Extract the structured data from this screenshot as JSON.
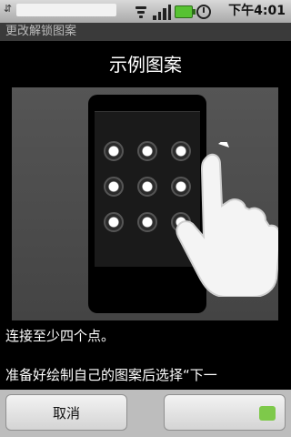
{
  "status_bar": {
    "time": "下午4:01",
    "icons": [
      "usb-icon",
      "wifi-icon",
      "signal-icon",
      "battery-icon",
      "alarm-icon"
    ],
    "battery_color": "#57c232"
  },
  "titlebar": {
    "text": "更改解锁图案"
  },
  "heading": "示例图案",
  "instructions": {
    "line1": "连接至少四个点。",
    "line2": "准备好绘制自己的图案后选择“下一"
  },
  "buttons": {
    "cancel": "取消",
    "next": ""
  }
}
